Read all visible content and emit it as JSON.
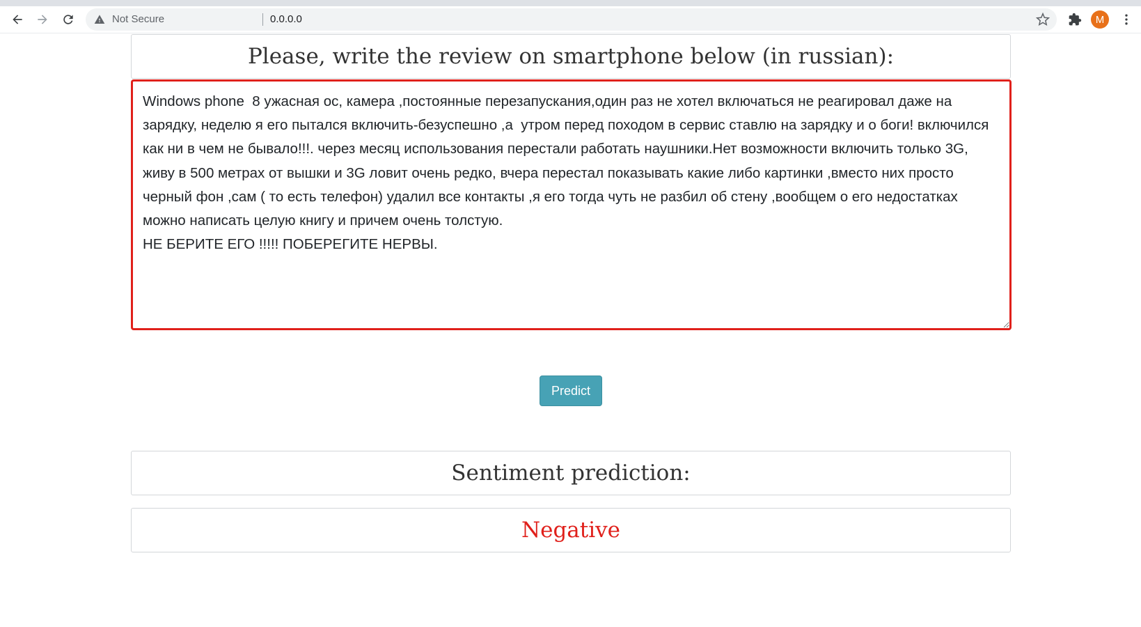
{
  "browser": {
    "security_label": "Not Secure",
    "url": "0.0.0.0",
    "profile_initial": "M",
    "icons": [
      "back-arrow-icon",
      "forward-arrow-icon",
      "reload-icon",
      "warning-icon",
      "star-icon",
      "puzzle-icon",
      "more-vert-icon"
    ]
  },
  "page": {
    "prompt_heading": "Please, write the review on smartphone below (in russian):",
    "review_text": "Windows phone  8 ужасная ос, камера ,постоянные перезапускания,один раз не хотел включаться не реагировал даже на зарядку, неделю я его пытался включить-безуспешно ,а  утром перед походом в сервис ставлю на зарядку и о боги! включился как ни в чем не бывало!!!. через месяц использования перестали работать наушники.Нет возможности включить только 3G, живу в 500 метрах от вышки и 3G ловит очень редко, вчера перестал показывать какие либо картинки ,вместо них просто черный фон ,сам ( то есть телефон) удалил все контакты ,я его тогда чуть не разбил об стену ,вообщем о его недостатках можно написать целую книгу и причем очень толстую.\nНЕ БЕРИТЕ ЕГО !!!!! ПОБЕРЕГИТЕ НЕРВЫ.",
    "predict_button": "Predict",
    "sentiment_heading": "Sentiment prediction:",
    "sentiment_result": "Negative"
  },
  "colors": {
    "accent_button": "#47a2b5",
    "highlight_border": "#e0201b",
    "result_text": "#e0201b",
    "avatar": "#e8711a"
  }
}
